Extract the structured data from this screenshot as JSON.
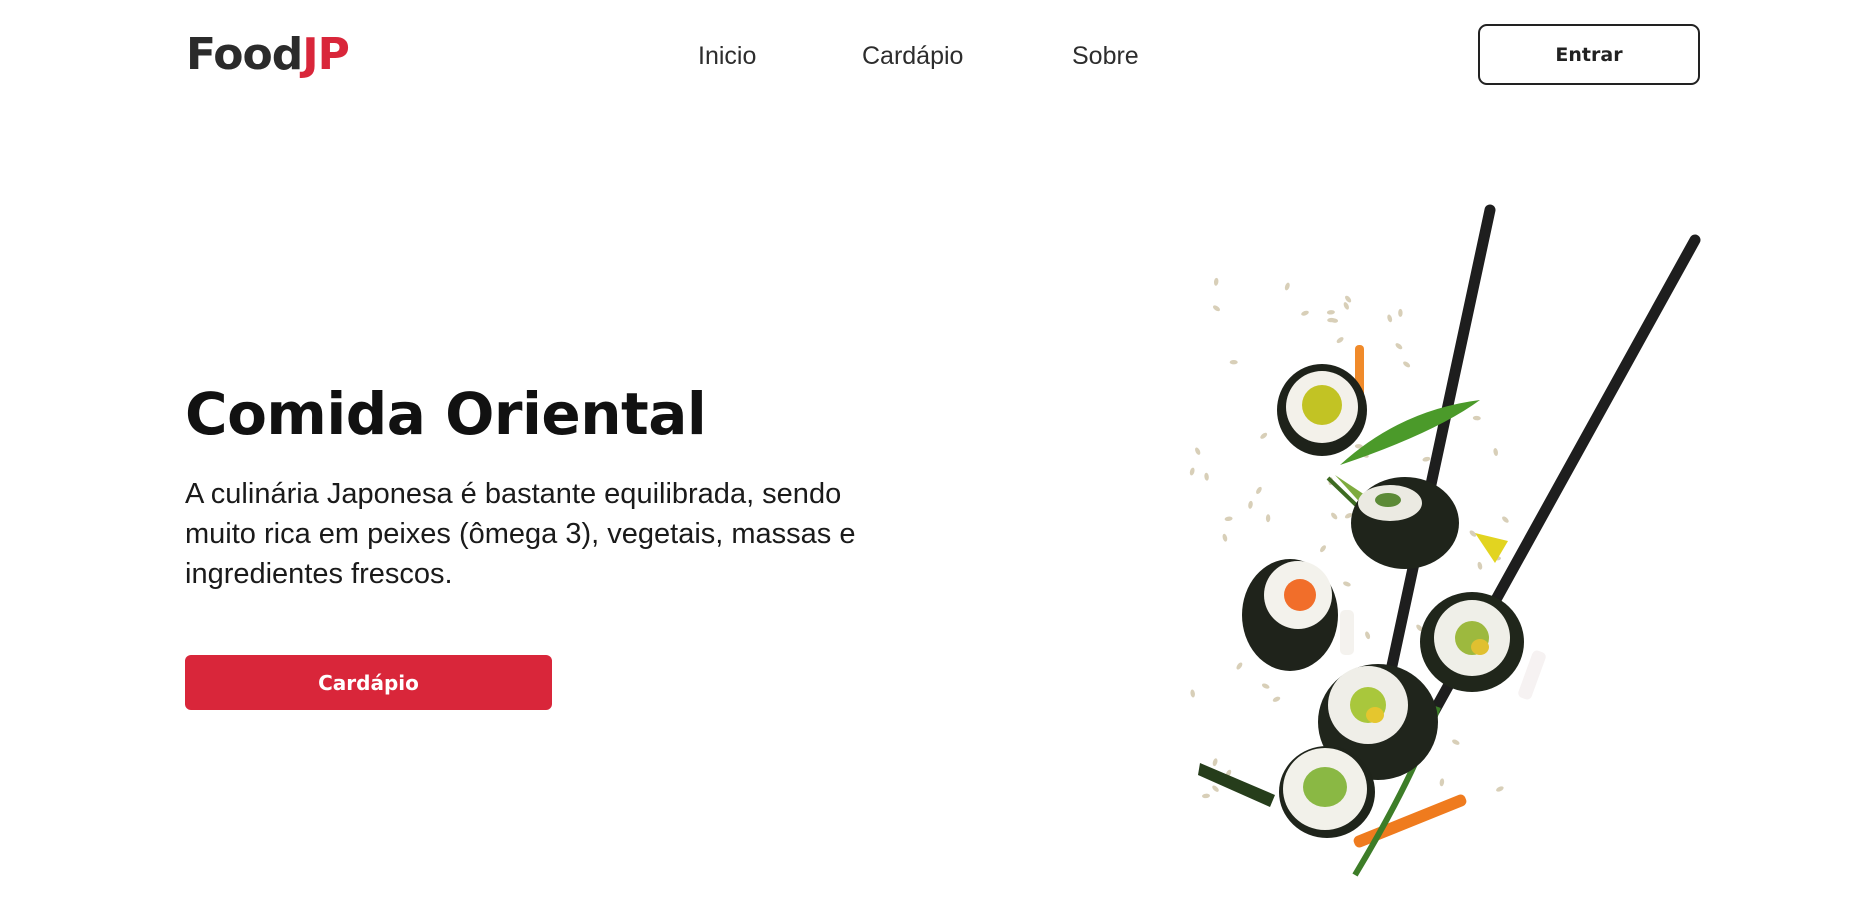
{
  "brand": {
    "name_main": "Food",
    "name_accent": "JP",
    "accent_color": "#d9263a"
  },
  "nav": {
    "items": [
      {
        "label": "Inicio"
      },
      {
        "label": "Cardápio"
      },
      {
        "label": "Sobre"
      }
    ]
  },
  "header": {
    "login_label": "Entrar"
  },
  "hero": {
    "title": "Comida Oriental",
    "description": "A culinária Japonesa é bastante equilibrada, sendo muito rica em peixes (ômega 3), vegetais, massas e ingredientes frescos.",
    "cta_label": "Cardápio",
    "image": "flying-sushi-rolls-with-chopsticks"
  }
}
